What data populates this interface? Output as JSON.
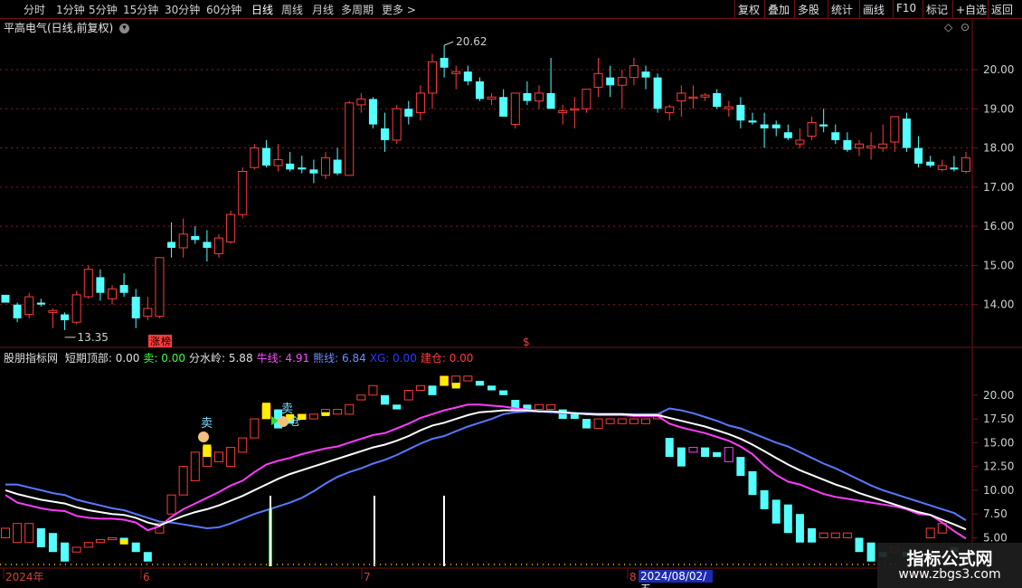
{
  "toolbar": {
    "periods": [
      "分时",
      "1分钟",
      "5分钟",
      "15分钟",
      "30分钟",
      "60分钟",
      "日线",
      "周线",
      "月线",
      "多周期",
      "更多 >"
    ],
    "active_period": "日线",
    "tools": [
      "复权",
      "叠加",
      "多股",
      "统计",
      "画线",
      "F10",
      "标记",
      "+自选",
      "返回"
    ]
  },
  "main_chart": {
    "title": "平高电气(日线,前复权)",
    "high_label": "20.62",
    "low_label": "13.35",
    "zhangting_label": "涨",
    "zhangting_label2": "榜",
    "dollar_mark": "$",
    "y_ticks": [
      20.0,
      19.0,
      18.0,
      17.0,
      16.0,
      15.0,
      14.0
    ],
    "colors": {
      "up": "#ff3c3c",
      "down": "#54ffff",
      "grid": "#8b1a1a",
      "border": "#7a1010"
    }
  },
  "sub_chart": {
    "name": "股朋指标网",
    "values": [
      {
        "label": "短期顶部: 0.00",
        "color": "#e0e0e0"
      },
      {
        "label": "卖: 0.00",
        "color": "#3cff3c"
      },
      {
        "label": "分水岭: 5.88",
        "color": "#e0e0e0"
      },
      {
        "label": "牛线: 4.91",
        "color": "#ff4cff"
      },
      {
        "label": "熊线: 6.84",
        "color": "#6f8cff"
      },
      {
        "label": "XG: 0.00",
        "color": "#2b3cff"
      },
      {
        "label": "建仓: 0.00",
        "color": "#ff3c3c"
      }
    ],
    "y_ticks": [
      20.0,
      17.5,
      15.0,
      12.5,
      10.0,
      7.5,
      5.0
    ],
    "sell_label": "卖",
    "build_label": "仓",
    "colors": {
      "bull": "#ff3cff",
      "bear": "#5a78ff",
      "water": "#ffffff"
    }
  },
  "x_axis": {
    "labels": [
      "2024年",
      "6",
      "7",
      "8"
    ],
    "date_box": "2024/08/02/五"
  },
  "watermark": {
    "line1": "指标公式网",
    "line2": "www.zbgs3.com"
  },
  "chart_data": [
    {
      "type": "candlestick",
      "title": "平高电气(日线,前复权)",
      "ylim": [
        13.0,
        20.9
      ],
      "x_labels": [
        "2024年",
        "6",
        "7",
        "8"
      ],
      "high": 20.62,
      "low": 13.35,
      "ohlc": [
        [
          14.25,
          14.2,
          14.15,
          14.05
        ],
        [
          14.0,
          14.05,
          13.55,
          13.65
        ],
        [
          13.75,
          14.3,
          13.65,
          14.2
        ],
        [
          14.05,
          14.15,
          13.95,
          14.0
        ],
        [
          13.8,
          13.9,
          13.4,
          13.85
        ],
        [
          13.75,
          13.8,
          13.35,
          13.6
        ],
        [
          13.55,
          14.35,
          13.5,
          14.25
        ],
        [
          14.2,
          15.0,
          14.15,
          14.9
        ],
        [
          14.7,
          14.9,
          14.1,
          14.3
        ],
        [
          14.15,
          14.5,
          14.0,
          14.4
        ],
        [
          14.5,
          14.8,
          14.2,
          14.3
        ],
        [
          14.2,
          14.4,
          13.4,
          13.65
        ],
        [
          13.7,
          14.2,
          13.6,
          13.9
        ],
        [
          13.7,
          15.2,
          13.65,
          15.2
        ],
        [
          15.6,
          16.1,
          15.2,
          15.45
        ],
        [
          15.45,
          16.2,
          15.2,
          15.8
        ],
        [
          15.75,
          16.0,
          15.55,
          15.65
        ],
        [
          15.6,
          15.9,
          15.1,
          15.45
        ],
        [
          15.3,
          15.8,
          15.2,
          15.7
        ],
        [
          15.6,
          16.4,
          15.55,
          16.3
        ],
        [
          16.3,
          17.5,
          16.2,
          17.4
        ],
        [
          17.5,
          18.1,
          17.45,
          18.0
        ],
        [
          18.0,
          18.2,
          17.5,
          17.55
        ],
        [
          17.55,
          18.1,
          17.4,
          17.7
        ],
        [
          17.6,
          17.9,
          17.4,
          17.45
        ],
        [
          17.5,
          17.8,
          17.35,
          17.45
        ],
        [
          17.45,
          17.7,
          17.1,
          17.35
        ],
        [
          17.3,
          17.9,
          17.2,
          17.75
        ],
        [
          17.7,
          18.0,
          17.3,
          17.35
        ],
        [
          17.3,
          19.2,
          17.3,
          19.15
        ],
        [
          19.1,
          19.4,
          18.9,
          19.25
        ],
        [
          19.25,
          19.3,
          18.5,
          18.6
        ],
        [
          18.5,
          18.9,
          17.9,
          18.2
        ],
        [
          18.2,
          19.1,
          18.1,
          19.0
        ],
        [
          19.0,
          19.2,
          18.6,
          18.8
        ],
        [
          18.9,
          19.6,
          18.7,
          19.4
        ],
        [
          19.4,
          20.4,
          19.0,
          20.2
        ],
        [
          20.3,
          20.62,
          19.8,
          20.05
        ],
        [
          19.9,
          20.1,
          19.5,
          19.95
        ],
        [
          19.95,
          20.1,
          19.6,
          19.7
        ],
        [
          19.7,
          19.8,
          19.2,
          19.25
        ],
        [
          19.25,
          19.4,
          19.1,
          19.3
        ],
        [
          19.3,
          19.5,
          18.9,
          18.8
        ],
        [
          18.6,
          19.4,
          18.5,
          19.4
        ],
        [
          19.4,
          19.7,
          19.1,
          19.2
        ],
        [
          19.2,
          19.6,
          19.0,
          19.4
        ],
        [
          19.4,
          20.3,
          19.0,
          19.0
        ],
        [
          18.9,
          19.1,
          18.6,
          18.95
        ],
        [
          19.0,
          19.3,
          18.5,
          19.0
        ],
        [
          19.0,
          19.5,
          18.9,
          19.5
        ],
        [
          19.55,
          20.3,
          19.3,
          19.9
        ],
        [
          19.8,
          20.1,
          19.3,
          19.6
        ],
        [
          19.6,
          20.0,
          19.0,
          19.8
        ],
        [
          19.8,
          20.3,
          19.6,
          20.1
        ],
        [
          19.95,
          20.1,
          19.5,
          19.8
        ],
        [
          19.8,
          19.9,
          18.9,
          19.0
        ],
        [
          18.9,
          19.1,
          18.7,
          19.05
        ],
        [
          19.2,
          19.6,
          18.8,
          19.4
        ],
        [
          19.3,
          19.6,
          19.0,
          19.3
        ],
        [
          19.3,
          19.4,
          19.2,
          19.35
        ],
        [
          19.4,
          19.5,
          19.0,
          19.05
        ],
        [
          19.0,
          19.2,
          18.8,
          19.05
        ],
        [
          19.1,
          19.3,
          18.5,
          18.7
        ],
        [
          18.7,
          18.9,
          18.6,
          18.65
        ],
        [
          18.6,
          18.9,
          18.0,
          18.5
        ],
        [
          18.6,
          18.7,
          18.3,
          18.5
        ],
        [
          18.4,
          18.6,
          18.2,
          18.25
        ],
        [
          18.1,
          18.5,
          18.0,
          18.2
        ],
        [
          18.3,
          18.8,
          18.2,
          18.65
        ],
        [
          18.6,
          19.0,
          18.4,
          18.55
        ],
        [
          18.4,
          18.6,
          18.1,
          18.2
        ],
        [
          18.2,
          18.4,
          17.9,
          17.95
        ],
        [
          18.0,
          18.2,
          17.8,
          18.1
        ],
        [
          18.0,
          18.4,
          17.7,
          18.05
        ],
        [
          18.0,
          18.6,
          17.9,
          18.1
        ],
        [
          18.15,
          18.8,
          17.9,
          18.8
        ],
        [
          18.75,
          18.9,
          17.9,
          18.0
        ],
        [
          18.0,
          18.3,
          17.5,
          17.6
        ],
        [
          17.65,
          17.8,
          17.5,
          17.55
        ],
        [
          17.45,
          17.7,
          17.4,
          17.55
        ],
        [
          17.5,
          17.8,
          17.4,
          17.45
        ],
        [
          17.4,
          17.9,
          17.35,
          17.75
        ]
      ]
    },
    {
      "type": "line",
      "title": "股朋指标网",
      "ylim": [
        2.0,
        23.5
      ],
      "legend": [
        "短期顶部: 0.00",
        "卖: 0.00",
        "分水岭: 5.88",
        "牛线: 4.91",
        "熊线: 6.84",
        "XG: 0.00",
        "建仓: 0.00"
      ],
      "signal_bars": [
        [
          5.0,
          6.0
        ],
        [
          4.5,
          6.5
        ],
        [
          4.5,
          6.5
        ],
        [
          4.0,
          6.0
        ],
        [
          3.5,
          5.5
        ],
        [
          2.5,
          4.5
        ],
        [
          3.5,
          4.0
        ],
        [
          4.0,
          4.5
        ],
        [
          4.5,
          4.8
        ],
        [
          4.8,
          5.0
        ],
        [
          4.5,
          5.0
        ],
        [
          3.5,
          4.5
        ],
        [
          2.5,
          3.5
        ],
        [
          5.5,
          6.5
        ],
        [
          7.5,
          9.5
        ],
        [
          9.5,
          12.5
        ],
        [
          11.0,
          14.0
        ],
        [
          12.5,
          14.5
        ],
        [
          13.0,
          14.0
        ],
        [
          12.5,
          14.5
        ],
        [
          14.0,
          15.5
        ],
        [
          15.5,
          17.5
        ],
        [
          17.5,
          19.0
        ],
        [
          16.5,
          18.5
        ],
        [
          17.0,
          17.5
        ],
        [
          17.5,
          18.0
        ],
        [
          17.5,
          18.0
        ],
        [
          18.0,
          18.5
        ],
        [
          18.0,
          18.5
        ],
        [
          18.0,
          19.0
        ],
        [
          19.5,
          20.0
        ],
        [
          20.0,
          21.0
        ],
        [
          19.0,
          20.0
        ],
        [
          18.5,
          19.0
        ],
        [
          19.5,
          20.5
        ],
        [
          20.5,
          21.0
        ],
        [
          20.0,
          21.0
        ],
        [
          21.0,
          22.0
        ],
        [
          21.0,
          22.0
        ],
        [
          21.5,
          22.0
        ],
        [
          21.0,
          21.5
        ],
        [
          20.5,
          21.0
        ],
        [
          20.0,
          20.5
        ],
        [
          18.5,
          19.5
        ],
        [
          18.5,
          19.0
        ],
        [
          18.5,
          19.0
        ],
        [
          18.5,
          19.0
        ],
        [
          17.5,
          18.5
        ],
        [
          17.5,
          18.0
        ],
        [
          16.5,
          17.5
        ],
        [
          16.5,
          17.5
        ],
        [
          17.0,
          17.5
        ],
        [
          17.0,
          17.5
        ],
        [
          17.0,
          17.5
        ],
        [
          17.0,
          17.5
        ],
        [
          17.5,
          18.0
        ],
        [
          13.5,
          15.5
        ],
        [
          12.5,
          14.5
        ],
        [
          14.0,
          14.5
        ],
        [
          13.5,
          14.5
        ],
        [
          13.5,
          14.0
        ],
        [
          13.0,
          14.5
        ],
        [
          11.5,
          13.5
        ],
        [
          9.5,
          12.0
        ],
        [
          8.0,
          10.0
        ],
        [
          6.5,
          9.0
        ],
        [
          5.5,
          8.5
        ],
        [
          4.5,
          7.5
        ],
        [
          4.5,
          6.0
        ],
        [
          5.0,
          5.5
        ],
        [
          5.0,
          5.5
        ],
        [
          5.0,
          5.5
        ],
        [
          3.5,
          5.0
        ],
        [
          2.5,
          4.5
        ],
        [
          3.0,
          3.5
        ],
        [
          3.5,
          4.0
        ],
        [
          3.0,
          3.5
        ],
        [
          2.0,
          3.0
        ],
        [
          5.0,
          6.0
        ],
        [
          5.5,
          6.5
        ],
        [
          3.5,
          4.0
        ],
        [
          2.5,
          3.0
        ]
      ],
      "series": [
        {
          "name": "牛线",
          "values": [
            9.5,
            8.7,
            8.4,
            8.1,
            7.9,
            7.8,
            7.3,
            7.1,
            7.0,
            7.0,
            6.9,
            6.6,
            5.8,
            6.2,
            7.2,
            8.0,
            8.6,
            9.2,
            9.8,
            10.5,
            11.0,
            11.9,
            12.7,
            13.1,
            13.4,
            13.8,
            14.1,
            14.4,
            14.6,
            15.0,
            15.4,
            15.8,
            16.0,
            16.5,
            17.0,
            17.6,
            18.0,
            18.4,
            18.7,
            19.0,
            19.0,
            18.9,
            18.8,
            18.6,
            18.5,
            18.3,
            18.2,
            18.2,
            18.1,
            18.0,
            17.9,
            17.9,
            17.9,
            17.8,
            17.8,
            17.8,
            17.0,
            16.6,
            16.3,
            16.0,
            15.6,
            15.2,
            14.6,
            13.8,
            12.6,
            11.6,
            10.9,
            10.6,
            10.1,
            9.6,
            9.3,
            9.1,
            8.9,
            8.7,
            8.5,
            8.3,
            8.0,
            7.5,
            7.4,
            6.6,
            5.7,
            4.91
          ]
        },
        {
          "name": "熊线",
          "values": [
            10.6,
            10.6,
            10.3,
            10.0,
            9.7,
            9.5,
            9.0,
            8.7,
            8.4,
            8.1,
            7.9,
            7.5,
            7.1,
            6.7,
            6.6,
            6.4,
            6.2,
            6.0,
            6.1,
            6.5,
            7.0,
            7.5,
            7.9,
            8.3,
            8.7,
            9.2,
            9.9,
            10.7,
            11.4,
            11.9,
            12.3,
            12.8,
            13.2,
            13.7,
            14.3,
            14.9,
            15.4,
            15.7,
            16.2,
            16.7,
            17.1,
            17.5,
            18.0,
            18.2,
            18.3,
            18.3,
            18.2,
            18.1,
            18.1,
            18.1,
            18.0,
            18.0,
            18.0,
            18.0,
            18.0,
            18.0,
            18.6,
            18.4,
            18.1,
            17.7,
            17.3,
            16.8,
            16.5,
            16.0,
            15.5,
            15.0,
            14.6,
            14.0,
            13.4,
            12.8,
            12.3,
            11.7,
            11.1,
            10.5,
            10.0,
            9.6,
            9.2,
            8.8,
            8.4,
            8.0,
            7.6,
            6.84
          ]
        },
        {
          "name": "分水岭",
          "values": [
            10.0,
            9.6,
            9.3,
            9.0,
            8.8,
            8.6,
            8.2,
            7.9,
            7.7,
            7.5,
            7.4,
            7.1,
            6.6,
            6.3,
            6.8,
            7.3,
            7.7,
            8.0,
            8.4,
            8.9,
            9.4,
            10.0,
            10.6,
            11.2,
            11.7,
            12.1,
            12.5,
            12.9,
            13.3,
            13.7,
            14.1,
            14.5,
            14.8,
            15.2,
            15.7,
            16.3,
            16.8,
            17.1,
            17.5,
            17.9,
            18.2,
            18.3,
            18.4,
            18.4,
            18.4,
            18.3,
            18.3,
            18.2,
            18.1,
            18.0,
            18.0,
            18.0,
            18.0,
            17.9,
            17.9,
            17.9,
            17.6,
            17.3,
            17.0,
            16.7,
            16.3,
            15.9,
            15.4,
            14.8,
            14.1,
            13.4,
            12.7,
            12.1,
            11.6,
            11.1,
            10.6,
            10.2,
            9.7,
            9.3,
            8.9,
            8.5,
            8.1,
            7.7,
            7.4,
            6.9,
            6.4,
            5.88
          ]
        }
      ]
    }
  ]
}
